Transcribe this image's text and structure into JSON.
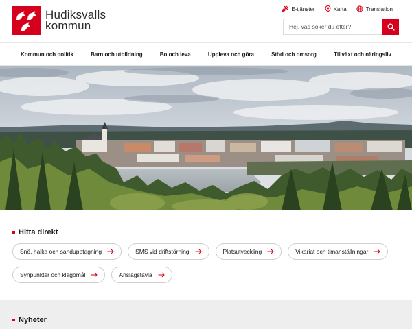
{
  "header": {
    "logo_line1": "Hudiksvalls",
    "logo_line2": "kommun",
    "toplinks": [
      {
        "label": "E-tjänster",
        "icon": "tools-icon"
      },
      {
        "label": "Karta",
        "icon": "map-pin-icon"
      },
      {
        "label": "Translation",
        "icon": "globe-icon"
      }
    ],
    "search_placeholder": "Hej, vad söker du efter?"
  },
  "nav": {
    "items": [
      "Kommun och politik",
      "Barn och utbildning",
      "Bo och leva",
      "Uppleva och göra",
      "Stöd och omsorg",
      "Tillväxt och näringsliv"
    ]
  },
  "direct": {
    "title": "Hitta direkt",
    "links": [
      "Snö, halka och sandupptagning",
      "SMS vid driftstörning",
      "Platsutveckling",
      "Vikariat och timanställningar",
      "Synpunkter och klagomål",
      "Anslagstavla"
    ]
  },
  "news": {
    "title": "Nyheter"
  },
  "colors": {
    "accent": "#d6001c",
    "border": "#cfcfcf",
    "section_bg": "#eeeeee"
  }
}
